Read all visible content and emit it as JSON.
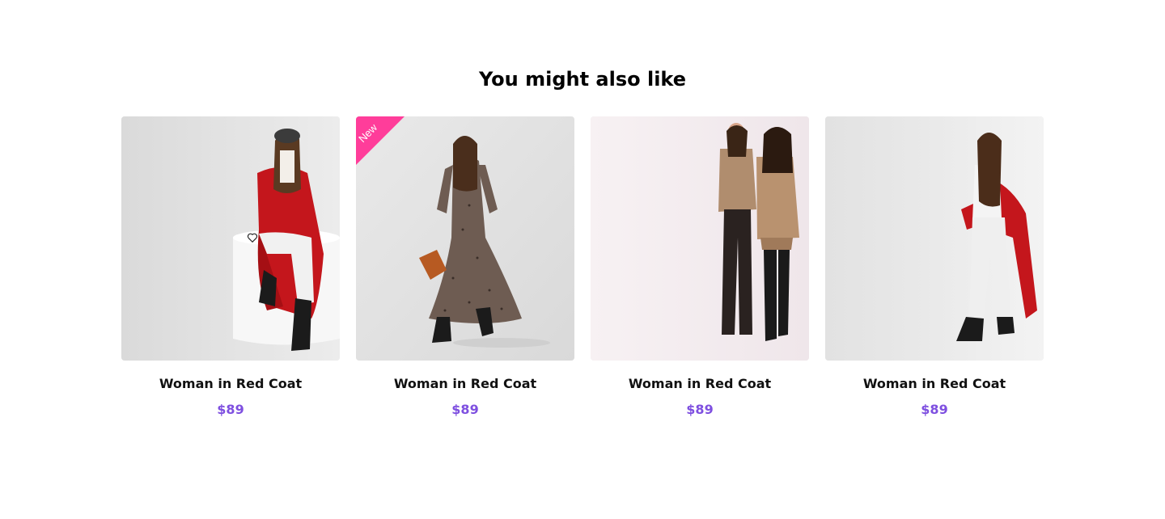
{
  "section": {
    "title": "You might also like"
  },
  "products": [
    {
      "name": "Woman in Red Coat",
      "price": "$89",
      "badge": "",
      "image": "woman-red-coat-seated-photo"
    },
    {
      "name": "Woman in Red Coat",
      "price": "$89",
      "badge": "New",
      "image": "woman-leopard-dress-photo"
    },
    {
      "name": "Woman in Red Coat",
      "price": "$89",
      "badge": "",
      "image": "two-women-beige-suits-photo"
    },
    {
      "name": "Woman in Red Coat",
      "price": "$89",
      "badge": "",
      "image": "woman-red-coat-standing-photo"
    }
  ],
  "colors": {
    "price": "#7e4fe0",
    "badge": "#ff3d9a",
    "title": "#000000"
  },
  "icons": {
    "wishlist": "heart-outline-icon"
  }
}
